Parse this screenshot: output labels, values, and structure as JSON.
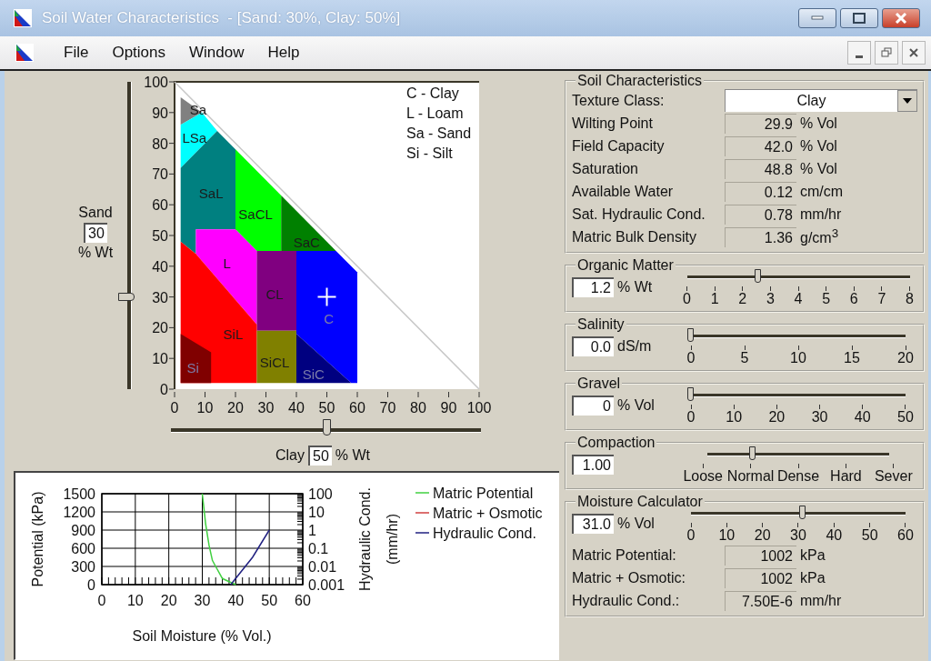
{
  "window": {
    "title": "Soil Water Characteristics  - [Sand: 30%, Clay: 50%]"
  },
  "menu": [
    "File",
    "Options",
    "Window",
    "Help"
  ],
  "texture_triangle": {
    "sand": {
      "label": "Sand",
      "value": "30",
      "unit": "% Wt",
      "level": 0.3
    },
    "clay": {
      "label": "Clay",
      "value": "50",
      "unit": "% Wt",
      "level": 0.5
    },
    "yticks": [
      "100",
      "90",
      "80",
      "70",
      "60",
      "50",
      "40",
      "30",
      "20",
      "10",
      "0"
    ],
    "xticks": [
      "0",
      "10",
      "20",
      "30",
      "40",
      "50",
      "60",
      "70",
      "80",
      "90",
      "100"
    ],
    "legend": [
      "C - Clay",
      "L  - Loam",
      "Sa - Sand",
      "Si - Silt"
    ],
    "regions": [
      {
        "label": "Sa",
        "color": "#808080"
      },
      {
        "label": "LSa",
        "color": "#00ffff"
      },
      {
        "label": "SaL",
        "color": "#008080"
      },
      {
        "label": "SaCL",
        "color": "#00ff00"
      },
      {
        "label": "SaC",
        "color": "#008000"
      },
      {
        "label": "L",
        "color": "#ff00ff"
      },
      {
        "label": "CL",
        "color": "#800080"
      },
      {
        "label": "C",
        "color": "#0000ff"
      },
      {
        "label": "SiL",
        "color": "#ff0000"
      },
      {
        "label": "Si",
        "color": "#800000"
      },
      {
        "label": "SiCL",
        "color": "#808000"
      },
      {
        "label": "SiC",
        "color": "#000080"
      }
    ]
  },
  "moisture_chart": {
    "chart_data": {
      "type": "line",
      "xlabel": "Soil Moisture (% Vol.)",
      "ylabel": "Potential (kPa)",
      "x": [
        30,
        31,
        32,
        33,
        34,
        35,
        36,
        38,
        40
      ],
      "series": [
        {
          "name": "Matric Potential",
          "color": "#40d040",
          "values": [
            1500,
            1000,
            650,
            400,
            300,
            200,
            100,
            50,
            0
          ]
        },
        {
          "name": "Matric + Osmotic",
          "color": "#d04040",
          "values": [
            null,
            null,
            null,
            null,
            null,
            null,
            null,
            null,
            null
          ]
        }
      ],
      "xlim": [
        0,
        60
      ],
      "ylim": [
        0,
        1500
      ],
      "xticks": [
        0,
        10,
        20,
        30,
        40,
        50,
        60
      ],
      "yticks": [
        0,
        300,
        600,
        900,
        1200,
        1500
      ],
      "grid": true,
      "legend": "right"
    },
    "right_axis": {
      "name": "Hydraulic Cond.",
      "color": "#202080",
      "title": [
        "Hydraulic Cond.",
        "(mm/hr)"
      ],
      "ticks": [
        "100",
        "10",
        "1",
        "0.1",
        "0.01",
        "0.001"
      ]
    }
  },
  "soil_characteristics": {
    "title": "Soil Characteristics",
    "texture_class": {
      "label": "Texture Class:",
      "value": "Clay"
    },
    "properties": [
      {
        "label": "Wilting Point",
        "value": "29.9",
        "unit": "% Vol"
      },
      {
        "label": "Field Capacity",
        "value": "42.0",
        "unit": "% Vol"
      },
      {
        "label": "Saturation",
        "value": "48.8",
        "unit": "% Vol"
      },
      {
        "label": "Available Water",
        "value": "0.12",
        "unit": "cm/cm"
      },
      {
        "label": "Sat. Hydraulic Cond.",
        "value": "0.78",
        "unit": "mm/hr"
      },
      {
        "label": "Matric Bulk Density",
        "value": "1.36",
        "unit": "g/cm$^{3}$"
      }
    ]
  },
  "sliders": [
    {
      "title": "Organic Matter",
      "value": "1.2",
      "unit": "% Wt",
      "level": 0.32,
      "ticks": [
        "0",
        "1",
        "2",
        "3",
        "4",
        "5",
        "6",
        "7",
        "8"
      ]
    },
    {
      "title": "Salinity",
      "value": "0.0",
      "unit": "dS/m",
      "level": 0,
      "ticks": [
        "0",
        "5",
        "10",
        "15",
        "20"
      ]
    },
    {
      "title": "Gravel",
      "value": "0",
      "unit": "% Vol",
      "level": 0,
      "ticks": [
        "0",
        "10",
        "20",
        "30",
        "40",
        "50"
      ]
    },
    {
      "title": "Compaction",
      "value": "1.00",
      "level": 0.25,
      "ticks": [
        "Loose",
        "Normal",
        "Dense",
        "Hard",
        "Sever"
      ]
    }
  ],
  "moisture_calculator": {
    "title": "Moisture Calculator",
    "value": "31.0",
    "unit": "% Vol",
    "level": 0.52,
    "ticks": [
      "0",
      "10",
      "20",
      "30",
      "40",
      "50",
      "60"
    ],
    "outputs": [
      {
        "label": "Matric Potential:",
        "value": "1002",
        "unit": "kPa"
      },
      {
        "label": "Matric + Osmotic:",
        "value": "1002",
        "unit": "kPa"
      },
      {
        "label": "Hydraulic Cond.:",
        "value": "7.50E-6",
        "unit": "mm/hr"
      }
    ]
  }
}
